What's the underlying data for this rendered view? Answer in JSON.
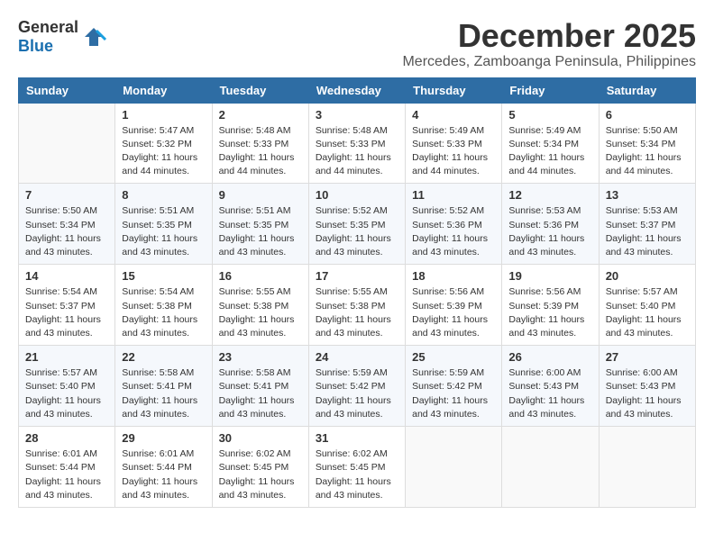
{
  "header": {
    "logo_general": "General",
    "logo_blue": "Blue",
    "month_title": "December 2025",
    "location": "Mercedes, Zamboanga Peninsula, Philippines"
  },
  "weekdays": [
    "Sunday",
    "Monday",
    "Tuesday",
    "Wednesday",
    "Thursday",
    "Friday",
    "Saturday"
  ],
  "weeks": [
    [
      {
        "day": "",
        "info": ""
      },
      {
        "day": "1",
        "info": "Sunrise: 5:47 AM\nSunset: 5:32 PM\nDaylight: 11 hours\nand 44 minutes."
      },
      {
        "day": "2",
        "info": "Sunrise: 5:48 AM\nSunset: 5:33 PM\nDaylight: 11 hours\nand 44 minutes."
      },
      {
        "day": "3",
        "info": "Sunrise: 5:48 AM\nSunset: 5:33 PM\nDaylight: 11 hours\nand 44 minutes."
      },
      {
        "day": "4",
        "info": "Sunrise: 5:49 AM\nSunset: 5:33 PM\nDaylight: 11 hours\nand 44 minutes."
      },
      {
        "day": "5",
        "info": "Sunrise: 5:49 AM\nSunset: 5:34 PM\nDaylight: 11 hours\nand 44 minutes."
      },
      {
        "day": "6",
        "info": "Sunrise: 5:50 AM\nSunset: 5:34 PM\nDaylight: 11 hours\nand 44 minutes."
      }
    ],
    [
      {
        "day": "7",
        "info": "Sunrise: 5:50 AM\nSunset: 5:34 PM\nDaylight: 11 hours\nand 43 minutes."
      },
      {
        "day": "8",
        "info": "Sunrise: 5:51 AM\nSunset: 5:35 PM\nDaylight: 11 hours\nand 43 minutes."
      },
      {
        "day": "9",
        "info": "Sunrise: 5:51 AM\nSunset: 5:35 PM\nDaylight: 11 hours\nand 43 minutes."
      },
      {
        "day": "10",
        "info": "Sunrise: 5:52 AM\nSunset: 5:35 PM\nDaylight: 11 hours\nand 43 minutes."
      },
      {
        "day": "11",
        "info": "Sunrise: 5:52 AM\nSunset: 5:36 PM\nDaylight: 11 hours\nand 43 minutes."
      },
      {
        "day": "12",
        "info": "Sunrise: 5:53 AM\nSunset: 5:36 PM\nDaylight: 11 hours\nand 43 minutes."
      },
      {
        "day": "13",
        "info": "Sunrise: 5:53 AM\nSunset: 5:37 PM\nDaylight: 11 hours\nand 43 minutes."
      }
    ],
    [
      {
        "day": "14",
        "info": "Sunrise: 5:54 AM\nSunset: 5:37 PM\nDaylight: 11 hours\nand 43 minutes."
      },
      {
        "day": "15",
        "info": "Sunrise: 5:54 AM\nSunset: 5:38 PM\nDaylight: 11 hours\nand 43 minutes."
      },
      {
        "day": "16",
        "info": "Sunrise: 5:55 AM\nSunset: 5:38 PM\nDaylight: 11 hours\nand 43 minutes."
      },
      {
        "day": "17",
        "info": "Sunrise: 5:55 AM\nSunset: 5:38 PM\nDaylight: 11 hours\nand 43 minutes."
      },
      {
        "day": "18",
        "info": "Sunrise: 5:56 AM\nSunset: 5:39 PM\nDaylight: 11 hours\nand 43 minutes."
      },
      {
        "day": "19",
        "info": "Sunrise: 5:56 AM\nSunset: 5:39 PM\nDaylight: 11 hours\nand 43 minutes."
      },
      {
        "day": "20",
        "info": "Sunrise: 5:57 AM\nSunset: 5:40 PM\nDaylight: 11 hours\nand 43 minutes."
      }
    ],
    [
      {
        "day": "21",
        "info": "Sunrise: 5:57 AM\nSunset: 5:40 PM\nDaylight: 11 hours\nand 43 minutes."
      },
      {
        "day": "22",
        "info": "Sunrise: 5:58 AM\nSunset: 5:41 PM\nDaylight: 11 hours\nand 43 minutes."
      },
      {
        "day": "23",
        "info": "Sunrise: 5:58 AM\nSunset: 5:41 PM\nDaylight: 11 hours\nand 43 minutes."
      },
      {
        "day": "24",
        "info": "Sunrise: 5:59 AM\nSunset: 5:42 PM\nDaylight: 11 hours\nand 43 minutes."
      },
      {
        "day": "25",
        "info": "Sunrise: 5:59 AM\nSunset: 5:42 PM\nDaylight: 11 hours\nand 43 minutes."
      },
      {
        "day": "26",
        "info": "Sunrise: 6:00 AM\nSunset: 5:43 PM\nDaylight: 11 hours\nand 43 minutes."
      },
      {
        "day": "27",
        "info": "Sunrise: 6:00 AM\nSunset: 5:43 PM\nDaylight: 11 hours\nand 43 minutes."
      }
    ],
    [
      {
        "day": "28",
        "info": "Sunrise: 6:01 AM\nSunset: 5:44 PM\nDaylight: 11 hours\nand 43 minutes."
      },
      {
        "day": "29",
        "info": "Sunrise: 6:01 AM\nSunset: 5:44 PM\nDaylight: 11 hours\nand 43 minutes."
      },
      {
        "day": "30",
        "info": "Sunrise: 6:02 AM\nSunset: 5:45 PM\nDaylight: 11 hours\nand 43 minutes."
      },
      {
        "day": "31",
        "info": "Sunrise: 6:02 AM\nSunset: 5:45 PM\nDaylight: 11 hours\nand 43 minutes."
      },
      {
        "day": "",
        "info": ""
      },
      {
        "day": "",
        "info": ""
      },
      {
        "day": "",
        "info": ""
      }
    ]
  ]
}
